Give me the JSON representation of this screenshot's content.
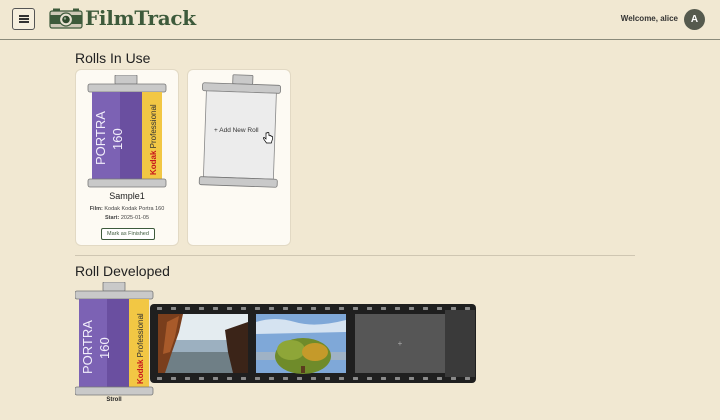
{
  "header": {
    "app_title": "FilmTrack",
    "welcome_text": "Welcome, alice",
    "avatar_initial": "A",
    "icons": {
      "menu": "hamburger-menu-icon",
      "logo": "camera-icon"
    }
  },
  "rolls_in_use": {
    "title": "Rolls In Use",
    "rolls": [
      {
        "name": "Sample1",
        "film_label": "Film:",
        "film_value": "Kodak Kodak Portra 160",
        "start_label": "Start:",
        "start_value": "2025-01-05",
        "action": "Mark as Finished",
        "canister": {
          "brand_line": "PORTRA",
          "iso_line": "160",
          "side_text": "Kodak Professional"
        }
      }
    ],
    "add_card": {
      "label": "+ Add New Roll"
    }
  },
  "roll_developed": {
    "title": "Roll Developed",
    "rolls": [
      {
        "name": "Stroll",
        "canister": {
          "brand_line": "PORTRA",
          "iso_line": "160",
          "side_text": "Kodak Professional"
        },
        "add_frame_label": "+"
      }
    ]
  },
  "colors": {
    "background": "#f1e8d2",
    "accent": "#3d5a3b",
    "canister_purple": "#6a4fa0",
    "canister_yellow": "#f2c744",
    "film_strip": "#1f1f1f"
  }
}
